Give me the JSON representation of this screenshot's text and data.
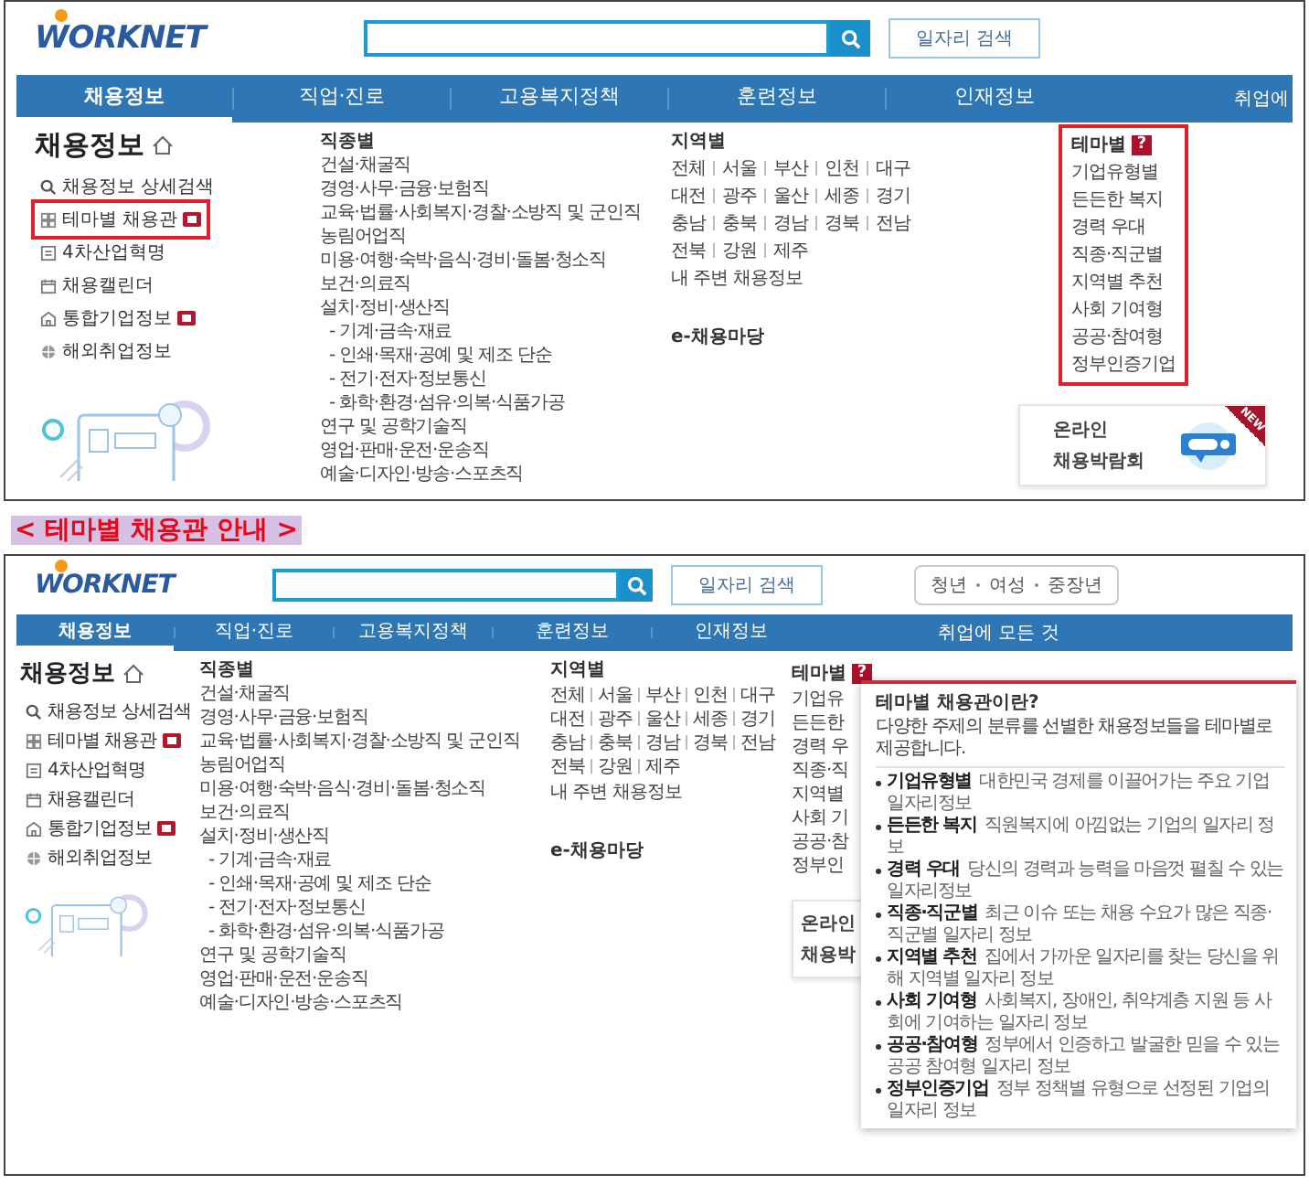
{
  "screens": [
    {
      "logo": "WORKNET",
      "search": {
        "button": "일자리 검색"
      },
      "nav": {
        "items": [
          {
            "label": "채용정보",
            "selected": true
          },
          {
            "label": "직업·진로",
            "selected": false
          },
          {
            "label": "고용복지정책",
            "selected": false
          },
          {
            "label": "훈련정보",
            "selected": false
          },
          {
            "label": "인재정보",
            "selected": false
          }
        ],
        "extra": "취업에"
      },
      "sidebar": {
        "title": "채용정보",
        "items": [
          {
            "label": "채용정보 상세검색",
            "kind": "search",
            "new": false,
            "highlighted": false
          },
          {
            "label": "테마별 채용관",
            "kind": "theme",
            "new": true,
            "highlighted": true
          },
          {
            "label": "4차산업혁명",
            "kind": "industry",
            "new": false,
            "highlighted": false
          },
          {
            "label": "채용캘린더",
            "kind": "calendar",
            "new": false,
            "highlighted": false
          },
          {
            "label": "통합기업정보",
            "kind": "company",
            "new": true,
            "highlighted": false
          },
          {
            "label": "해외취업정보",
            "kind": "globe",
            "new": false,
            "highlighted": false
          }
        ]
      },
      "jobs": {
        "title": "직종별",
        "items": [
          {
            "label": "건설·채굴직",
            "sub": false
          },
          {
            "label": "경영·사무·금융·보험직",
            "sub": false
          },
          {
            "label": "교육·법률·사회복지·경찰·소방직 및 군인직",
            "sub": false
          },
          {
            "label": "농림어업직",
            "sub": false
          },
          {
            "label": "미용·여행·숙박·음식·경비·돌봄·청소직",
            "sub": false
          },
          {
            "label": "보건·의료직",
            "sub": false
          },
          {
            "label": "설치·정비·생산직",
            "sub": false
          },
          {
            "label": "- 기계·금속·재료",
            "sub": true
          },
          {
            "label": "- 인쇄·목재·공예 및 제조 단순",
            "sub": true
          },
          {
            "label": "- 전기·전자·정보통신",
            "sub": true
          },
          {
            "label": "- 화학·환경·섬유·의복·식품가공",
            "sub": true
          },
          {
            "label": "연구 및 공학기술직",
            "sub": false
          },
          {
            "label": "영업·판매·운전·운송직",
            "sub": false
          },
          {
            "label": "예술·디자인·방송·스포츠직",
            "sub": false
          }
        ]
      },
      "regions": {
        "title": "지역별",
        "rows": [
          [
            "전체",
            "서울",
            "부산",
            "인천",
            "대구"
          ],
          [
            "대전",
            "광주",
            "울산",
            "세종",
            "경기"
          ],
          [
            "충남",
            "충북",
            "경남",
            "경북",
            "전남"
          ],
          [
            "전북",
            "강원",
            "제주"
          ]
        ],
        "nearby": "내 주변 채용정보",
        "fair": "e-채용마당"
      },
      "theme": {
        "title": "테마별",
        "help": "?",
        "highlighted": true,
        "items": [
          "기업유형별",
          "든든한 복지",
          "경력 우대",
          "직종·직군별",
          "지역별 추천",
          "사회 기여형",
          "공공·참여형",
          "정부인증기업"
        ]
      },
      "promo": {
        "lines": [
          "온라인",
          "채용박람회"
        ],
        "ribbon": "NEW"
      }
    },
    {
      "logo": "WORKNET",
      "search": {
        "button": "일자리 검색"
      },
      "audience": [
        "청년",
        "여성",
        "중장년"
      ],
      "nav": {
        "items": [
          {
            "label": "채용정보",
            "selected": true
          },
          {
            "label": "직업·진로",
            "selected": false
          },
          {
            "label": "고용복지정책",
            "selected": false
          },
          {
            "label": "훈련정보",
            "selected": false
          },
          {
            "label": "인재정보",
            "selected": false
          }
        ],
        "extra": "취업에 모든 것"
      },
      "sidebar": {
        "title": "채용정보",
        "items": [
          {
            "label": "채용정보 상세검색",
            "kind": "search",
            "new": false,
            "highlighted": false
          },
          {
            "label": "테마별 채용관",
            "kind": "theme",
            "new": true,
            "highlighted": false
          },
          {
            "label": "4차산업혁명",
            "kind": "industry",
            "new": false,
            "highlighted": false
          },
          {
            "label": "채용캘린더",
            "kind": "calendar",
            "new": false,
            "highlighted": false
          },
          {
            "label": "통합기업정보",
            "kind": "company",
            "new": true,
            "highlighted": false
          },
          {
            "label": "해외취업정보",
            "kind": "globe",
            "new": false,
            "highlighted": false
          }
        ]
      },
      "jobs": {
        "title": "직종별",
        "items": [
          {
            "label": "건설·채굴직",
            "sub": false
          },
          {
            "label": "경영·사무·금융·보험직",
            "sub": false
          },
          {
            "label": "교육·법률·사회복지·경찰·소방직 및 군인직",
            "sub": false
          },
          {
            "label": "농림어업직",
            "sub": false
          },
          {
            "label": "미용·여행·숙박·음식·경비·돌봄·청소직",
            "sub": false
          },
          {
            "label": "보건·의료직",
            "sub": false
          },
          {
            "label": "설치·정비·생산직",
            "sub": false
          },
          {
            "label": "- 기계·금속·재료",
            "sub": true
          },
          {
            "label": "- 인쇄·목재·공예 및 제조 단순",
            "sub": true
          },
          {
            "label": "- 전기·전자·정보통신",
            "sub": true
          },
          {
            "label": "- 화학·환경·섬유·의복·식품가공",
            "sub": true
          },
          {
            "label": "연구 및 공학기술직",
            "sub": false
          },
          {
            "label": "영업·판매·운전·운송직",
            "sub": false
          },
          {
            "label": "예술·디자인·방송·스포츠직",
            "sub": false
          }
        ]
      },
      "regions": {
        "title": "지역별",
        "rows": [
          [
            "전체",
            "서울",
            "부산",
            "인천",
            "대구"
          ],
          [
            "대전",
            "광주",
            "울산",
            "세종",
            "경기"
          ],
          [
            "충남",
            "충북",
            "경남",
            "경북",
            "전남"
          ],
          [
            "전북",
            "강원",
            "제주"
          ]
        ],
        "nearby": "내 주변 채용정보",
        "fair": "e-채용마당"
      },
      "theme": {
        "title": "테마별",
        "help": "?",
        "highlighted": false,
        "items": [
          "기업유",
          "든든한",
          "경력 우",
          "직종·직",
          "지역별",
          "사회 기",
          "공공·참",
          "정부인"
        ]
      },
      "promo": {
        "lines": [
          "온라인",
          "채용박"
        ]
      },
      "tooltip": {
        "title": "테마별 채용관이란?",
        "subtitle": "다양한 주제의 분류를 선별한 채용정보들을 테마별로 제공합니다.",
        "items": [
          {
            "label": "기업유형별",
            "desc": "대한민국 경제를 이끌어가는 주요 기업 일자리정보"
          },
          {
            "label": "든든한 복지",
            "desc": "직원복지에 아낌없는 기업의 일자리 정보"
          },
          {
            "label": "경력 우대",
            "desc": "당신의 경력과 능력을 마음껏 펼칠 수 있는 일자리정보"
          },
          {
            "label": "직종·직군별",
            "desc": "최근 이슈 또는 채용 수요가 많은 직종·직군별 일자리 정보"
          },
          {
            "label": "지역별 추천",
            "desc": "집에서 가까운 일자리를 찾는 당신을 위해 지역별 일자리 정보"
          },
          {
            "label": "사회 기여형",
            "desc": "사회복지, 장애인, 취약계층 지원 등 사회에 기여하는 일자리 정보"
          },
          {
            "label": "공공·참여형",
            "desc": "정부에서 인증하고 발굴한 믿을 수 있는 공공 참여형 일자리 정보"
          },
          {
            "label": "정부인증기업",
            "desc": "정부 정책별 유형으로 선정된 기업의 일자리 정보"
          }
        ]
      }
    }
  ],
  "caption": "< 테마별 채용관 안내 >"
}
